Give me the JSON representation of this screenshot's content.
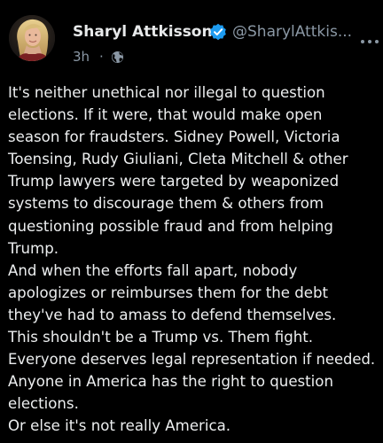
{
  "author": {
    "display_name": "Sharyl Attkisson",
    "handle": "@SharylAttkis...",
    "verified_icon": "verified-badge-icon",
    "avatar": "avatar"
  },
  "meta": {
    "time": "3h",
    "separator": "·",
    "audience_icon": "globe-icon"
  },
  "actions": {
    "more_icon": "more-options-icon"
  },
  "post": {
    "lines": [
      "It's neither unethical nor illegal to question",
      "elections. If it were, that would make open",
      "season for fraudsters. Sidney Powell, Victoria",
      "Toensing, Rudy Giuliani, Cleta Mitchell & other",
      "Trump lawyers were targeted by weaponized",
      "systems to discourage them & others from",
      "questioning possible fraud and from helping",
      "Trump.",
      "And when the efforts fall apart, nobody",
      "apologizes or reimburses them for the debt",
      "they've had to amass to defend themselves.",
      "This shouldn't be a Trump vs. Them fight.",
      "Everyone deserves legal representation if needed.",
      "Anyone in America has the right to question",
      "elections.",
      "Or else it's not really America."
    ]
  },
  "colors": {
    "background": "#000000",
    "text": "#e7e9ea",
    "secondary_text": "#8b98a5",
    "verified": "#1d9bf0"
  }
}
